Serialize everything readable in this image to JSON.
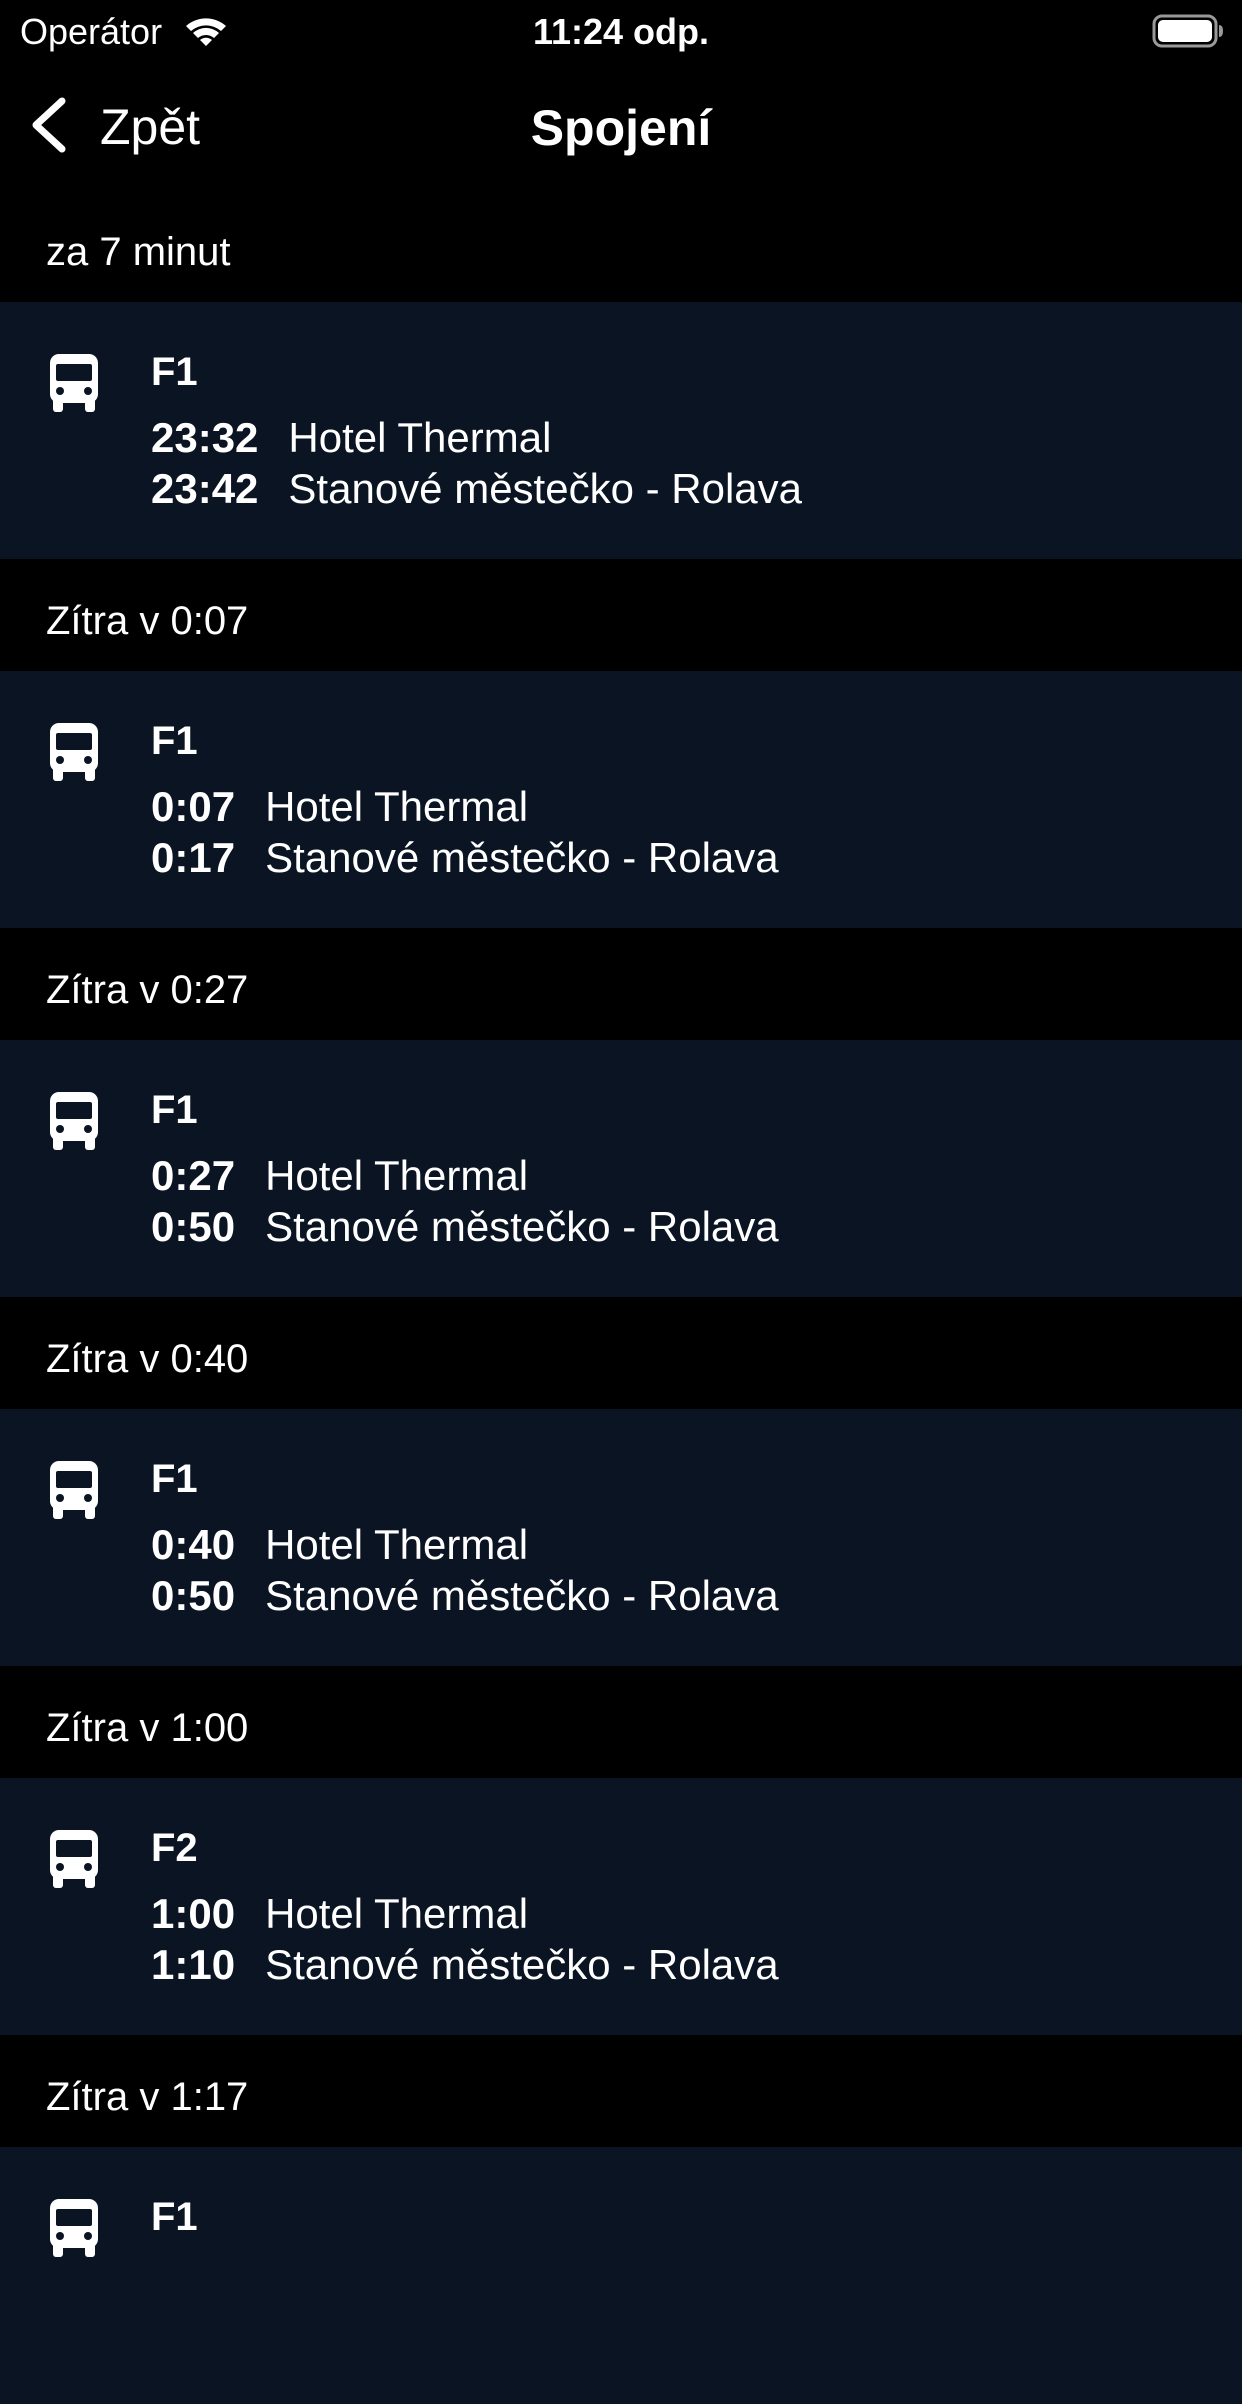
{
  "status_bar": {
    "carrier": "Operátor",
    "time": "11:24 odp."
  },
  "nav": {
    "back_label": "Zpět",
    "title": "Spojení"
  },
  "sections": [
    {
      "header": "za 7 minut",
      "line": "F1",
      "departure_time": "23:32",
      "departure_stop": "Hotel Thermal",
      "arrival_time": "23:42",
      "arrival_stop": "Stanové městečko - Rolava"
    },
    {
      "header": "Zítra v 0:07",
      "line": "F1",
      "departure_time": "0:07",
      "departure_stop": "Hotel Thermal",
      "arrival_time": "0:17",
      "arrival_stop": "Stanové městečko - Rolava"
    },
    {
      "header": "Zítra v 0:27",
      "line": "F1",
      "departure_time": "0:27",
      "departure_stop": "Hotel Thermal",
      "arrival_time": "0:50",
      "arrival_stop": "Stanové městečko - Rolava"
    },
    {
      "header": "Zítra v 0:40",
      "line": "F1",
      "departure_time": "0:40",
      "departure_stop": "Hotel Thermal",
      "arrival_time": "0:50",
      "arrival_stop": "Stanové městečko - Rolava"
    },
    {
      "header": "Zítra v 1:00",
      "line": "F2",
      "departure_time": "1:00",
      "departure_stop": "Hotel Thermal",
      "arrival_time": "1:10",
      "arrival_stop": "Stanové městečko - Rolava"
    },
    {
      "header": "Zítra v 1:17",
      "line": "F1",
      "departure_time": "",
      "departure_stop": "",
      "arrival_time": "",
      "arrival_stop": ""
    }
  ],
  "icons": {
    "wifi": "wifi-icon",
    "battery": "battery-icon",
    "back": "chevron-left-icon",
    "bus": "bus-icon"
  },
  "colors": {
    "background": "#000000",
    "row_background": "#0b1423",
    "text": "#ffffff"
  }
}
